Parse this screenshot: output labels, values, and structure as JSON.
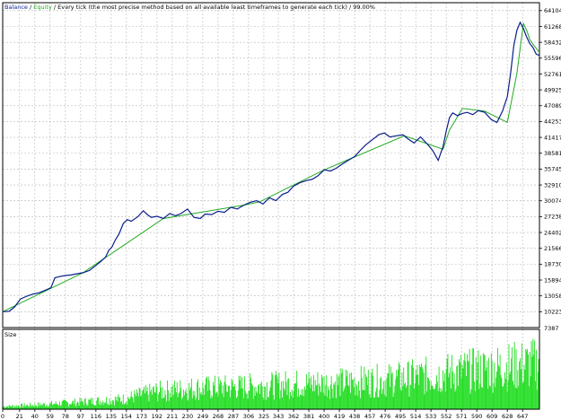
{
  "header": {
    "balance_label": "Balance",
    "separator": " / ",
    "equity_label": "Equity",
    "description": " / Every tick (the most precise method based on all available least timeframes to generate each tick) / 99.00%"
  },
  "volume_panel": {
    "label": "Size",
    "ytick": "7387"
  },
  "colors": {
    "balance": "#0a1e8c",
    "equity": "#22aa22",
    "volume": "#22dd22",
    "frame": "#000000",
    "grid": "#b8b8b8"
  },
  "chart_data": [
    {
      "type": "line",
      "title": "",
      "xlabel": "",
      "ylabel": "",
      "ytick_labels": [
        "64104",
        "61268",
        "58432",
        "55596",
        "52761",
        "49925",
        "47089",
        "44253",
        "41417",
        "38581",
        "35745",
        "32910",
        "30074",
        "27238",
        "24402",
        "21566",
        "18730",
        "15894",
        "13058",
        "10223"
      ],
      "ylim": [
        7387,
        65522
      ],
      "xlim": [
        0,
        668
      ],
      "grid": true,
      "series": [
        {
          "name": "Balance",
          "x": [
            0,
            8,
            15,
            22,
            30,
            38,
            45,
            52,
            60,
            65,
            70,
            78,
            85,
            92,
            100,
            108,
            116,
            122,
            128,
            132,
            136,
            140,
            145,
            150,
            155,
            160,
            168,
            175,
            180,
            185,
            192,
            200,
            208,
            215,
            222,
            230,
            238,
            246,
            252,
            260,
            268,
            276,
            284,
            292,
            300,
            308,
            316,
            324,
            332,
            340,
            348,
            355,
            362,
            370,
            378,
            385,
            392,
            400,
            408,
            415,
            422,
            430,
            438,
            445,
            452,
            460,
            468,
            475,
            482,
            490,
            498,
            505,
            512,
            520,
            528,
            535,
            542,
            548,
            552,
            556,
            560,
            566,
            572,
            578,
            585,
            592,
            600,
            608,
            615,
            622,
            628,
            632,
            636,
            640,
            644,
            648,
            652,
            656,
            660,
            664,
            668
          ],
          "y": [
            10223,
            10300,
            11100,
            12500,
            13000,
            13400,
            13600,
            14000,
            14500,
            16300,
            16500,
            16700,
            16800,
            17000,
            17200,
            17600,
            18500,
            19200,
            20000,
            21200,
            21800,
            23000,
            24200,
            26000,
            26700,
            26400,
            27200,
            28300,
            27600,
            27100,
            27300,
            26900,
            27800,
            27400,
            27800,
            28600,
            27100,
            26900,
            27700,
            27600,
            28200,
            28000,
            28900,
            28600,
            29300,
            29800,
            30100,
            29500,
            30600,
            30100,
            31200,
            31600,
            32700,
            33300,
            33700,
            33900,
            34500,
            35600,
            35400,
            35900,
            36600,
            37300,
            38000,
            39100,
            40100,
            41000,
            41900,
            42200,
            41500,
            41700,
            41900,
            41100,
            40400,
            41500,
            40300,
            39100,
            37300,
            39800,
            42600,
            44900,
            45800,
            45300,
            45700,
            45900,
            45500,
            46200,
            45900,
            44600,
            44100,
            46100,
            48700,
            52800,
            57800,
            60600,
            62000,
            60900,
            59400,
            58200,
            57500,
            56300,
            56100
          ]
        },
        {
          "name": "Equity",
          "x": [
            0,
            100,
            200,
            300,
            320,
            400,
            500,
            548,
            556,
            572,
            600,
            628,
            640,
            648,
            652,
            656,
            660,
            668
          ],
          "y": [
            10223,
            17200,
            26900,
            29300,
            29900,
            35600,
            41700,
            39300,
            42700,
            46600,
            46100,
            44100,
            52900,
            61800,
            60600,
            58900,
            58100,
            56600
          ]
        }
      ]
    },
    {
      "type": "bar",
      "title": "Size",
      "xlabel": "",
      "ylabel": "",
      "xtick_labels": [
        "0",
        "21",
        "40",
        "59",
        "78",
        "97",
        "116",
        "135",
        "154",
        "173",
        "192",
        "211",
        "230",
        "249",
        "268",
        "287",
        "306",
        "325",
        "343",
        "362",
        "381",
        "400",
        "419",
        "438",
        "457",
        "476",
        "495",
        "514",
        "533",
        "552",
        "571",
        "590",
        "609",
        "628",
        "647"
      ],
      "xlim": [
        0,
        668
      ],
      "ylim": [
        0,
        7387
      ],
      "grid": true,
      "envelope": {
        "x": [
          0,
          50,
          100,
          150,
          190,
          240,
          300,
          360,
          420,
          480,
          520,
          560,
          600,
          640,
          668
        ],
        "max": [
          400,
          700,
          1100,
          1500,
          2600,
          3100,
          3300,
          3700,
          3900,
          4300,
          4800,
          5400,
          5900,
          6400,
          6800
        ]
      }
    }
  ]
}
